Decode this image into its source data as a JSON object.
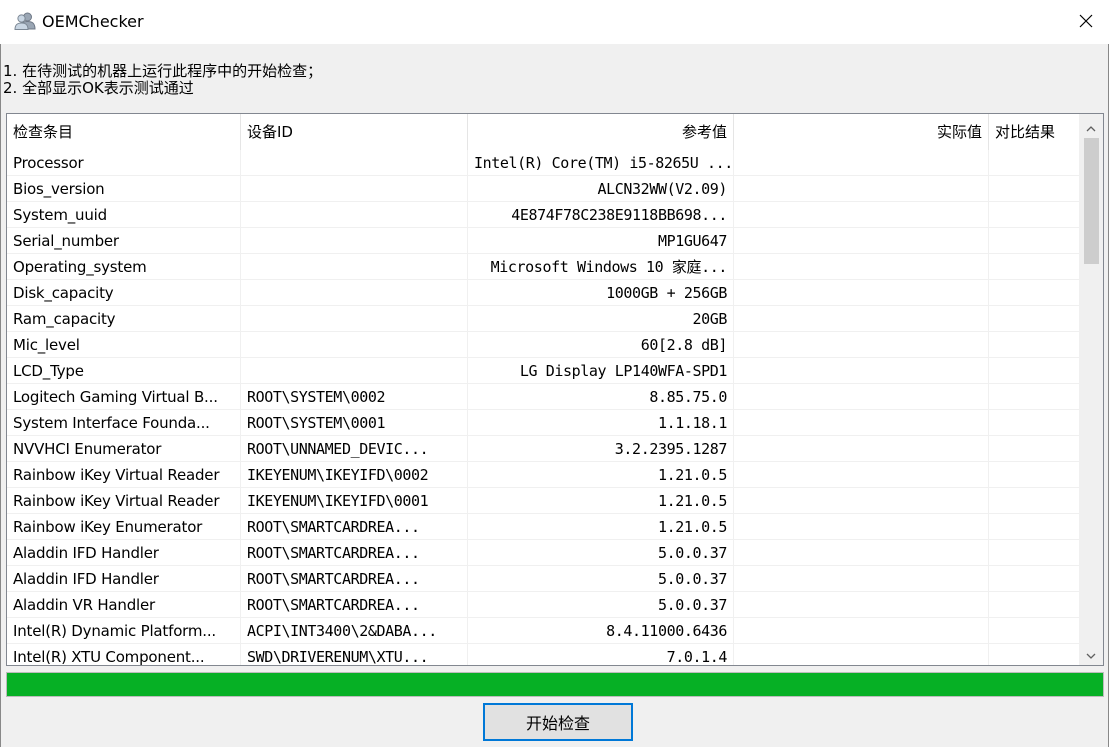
{
  "window": {
    "title": "OEMChecker"
  },
  "instructions": [
    "1. 在待测试的机器上运行此程序中的开始检查；",
    "2. 全部显示OK表示测试通过"
  ],
  "table": {
    "columns": [
      "检查条目",
      "设备ID",
      "参考值",
      "实际值",
      "对比结果"
    ],
    "rows": [
      [
        "Processor",
        "",
        "Intel(R) Core(TM) i5-8265U ...",
        "",
        ""
      ],
      [
        "Bios_version",
        "",
        "ALCN32WW(V2.09)",
        "",
        ""
      ],
      [
        "System_uuid",
        "",
        "4E874F78C238E9118BB698...",
        "",
        ""
      ],
      [
        "Serial_number",
        "",
        "MP1GU647",
        "",
        ""
      ],
      [
        "Operating_system",
        "",
        "Microsoft Windows 10 家庭...",
        "",
        ""
      ],
      [
        "Disk_capacity",
        "",
        "1000GB + 256GB",
        "",
        ""
      ],
      [
        "Ram_capacity",
        "",
        "20GB",
        "",
        ""
      ],
      [
        "Mic_level",
        "",
        "60[2.8 dB]",
        "",
        ""
      ],
      [
        "LCD_Type",
        "",
        "LG Display LP140WFA-SPD1",
        "",
        ""
      ],
      [
        "Logitech Gaming Virtual B...",
        "ROOT\\SYSTEM\\0002",
        "8.85.75.0",
        "",
        ""
      ],
      [
        "System Interface Founda...",
        "ROOT\\SYSTEM\\0001",
        "1.1.18.1",
        "",
        ""
      ],
      [
        "NVVHCI Enumerator",
        "ROOT\\UNNAMED_DEVIC...",
        "3.2.2395.1287",
        "",
        ""
      ],
      [
        "Rainbow iKey Virtual Reader",
        "IKEYENUM\\IKEYIFD\\0002",
        "1.21.0.5",
        "",
        ""
      ],
      [
        "Rainbow iKey Virtual Reader",
        "IKEYENUM\\IKEYIFD\\0001",
        "1.21.0.5",
        "",
        ""
      ],
      [
        "Rainbow iKey Enumerator",
        "ROOT\\SMARTCARDREA...",
        "1.21.0.5",
        "",
        ""
      ],
      [
        "Aladdin IFD Handler",
        "ROOT\\SMARTCARDREA...",
        "5.0.0.37",
        "",
        ""
      ],
      [
        "Aladdin IFD Handler",
        "ROOT\\SMARTCARDREA...",
        "5.0.0.37",
        "",
        ""
      ],
      [
        "Aladdin VR Handler",
        "ROOT\\SMARTCARDREA...",
        "5.0.0.37",
        "",
        ""
      ],
      [
        "Intel(R) Dynamic Platform...",
        "ACPI\\INT3400\\2&DABA...",
        "8.4.11000.6436",
        "",
        ""
      ],
      [
        "Intel(R) XTU Component...",
        "SWD\\DRIVERENUM\\XTU...",
        "7.0.1.4",
        "",
        ""
      ]
    ]
  },
  "scrollbar": {
    "thumb_start_fraction": 0.0,
    "thumb_length_fraction": 0.25
  },
  "progress": {
    "percent": 100,
    "color": "#06b025"
  },
  "buttons": {
    "start_label": "开始检查"
  },
  "icons": {
    "app": "users-icon",
    "close": "close-icon",
    "scroll_up": "chevron-up-icon",
    "scroll_down": "chevron-down-icon"
  },
  "colors": {
    "accent": "#0078d7",
    "progress": "#06b025"
  }
}
